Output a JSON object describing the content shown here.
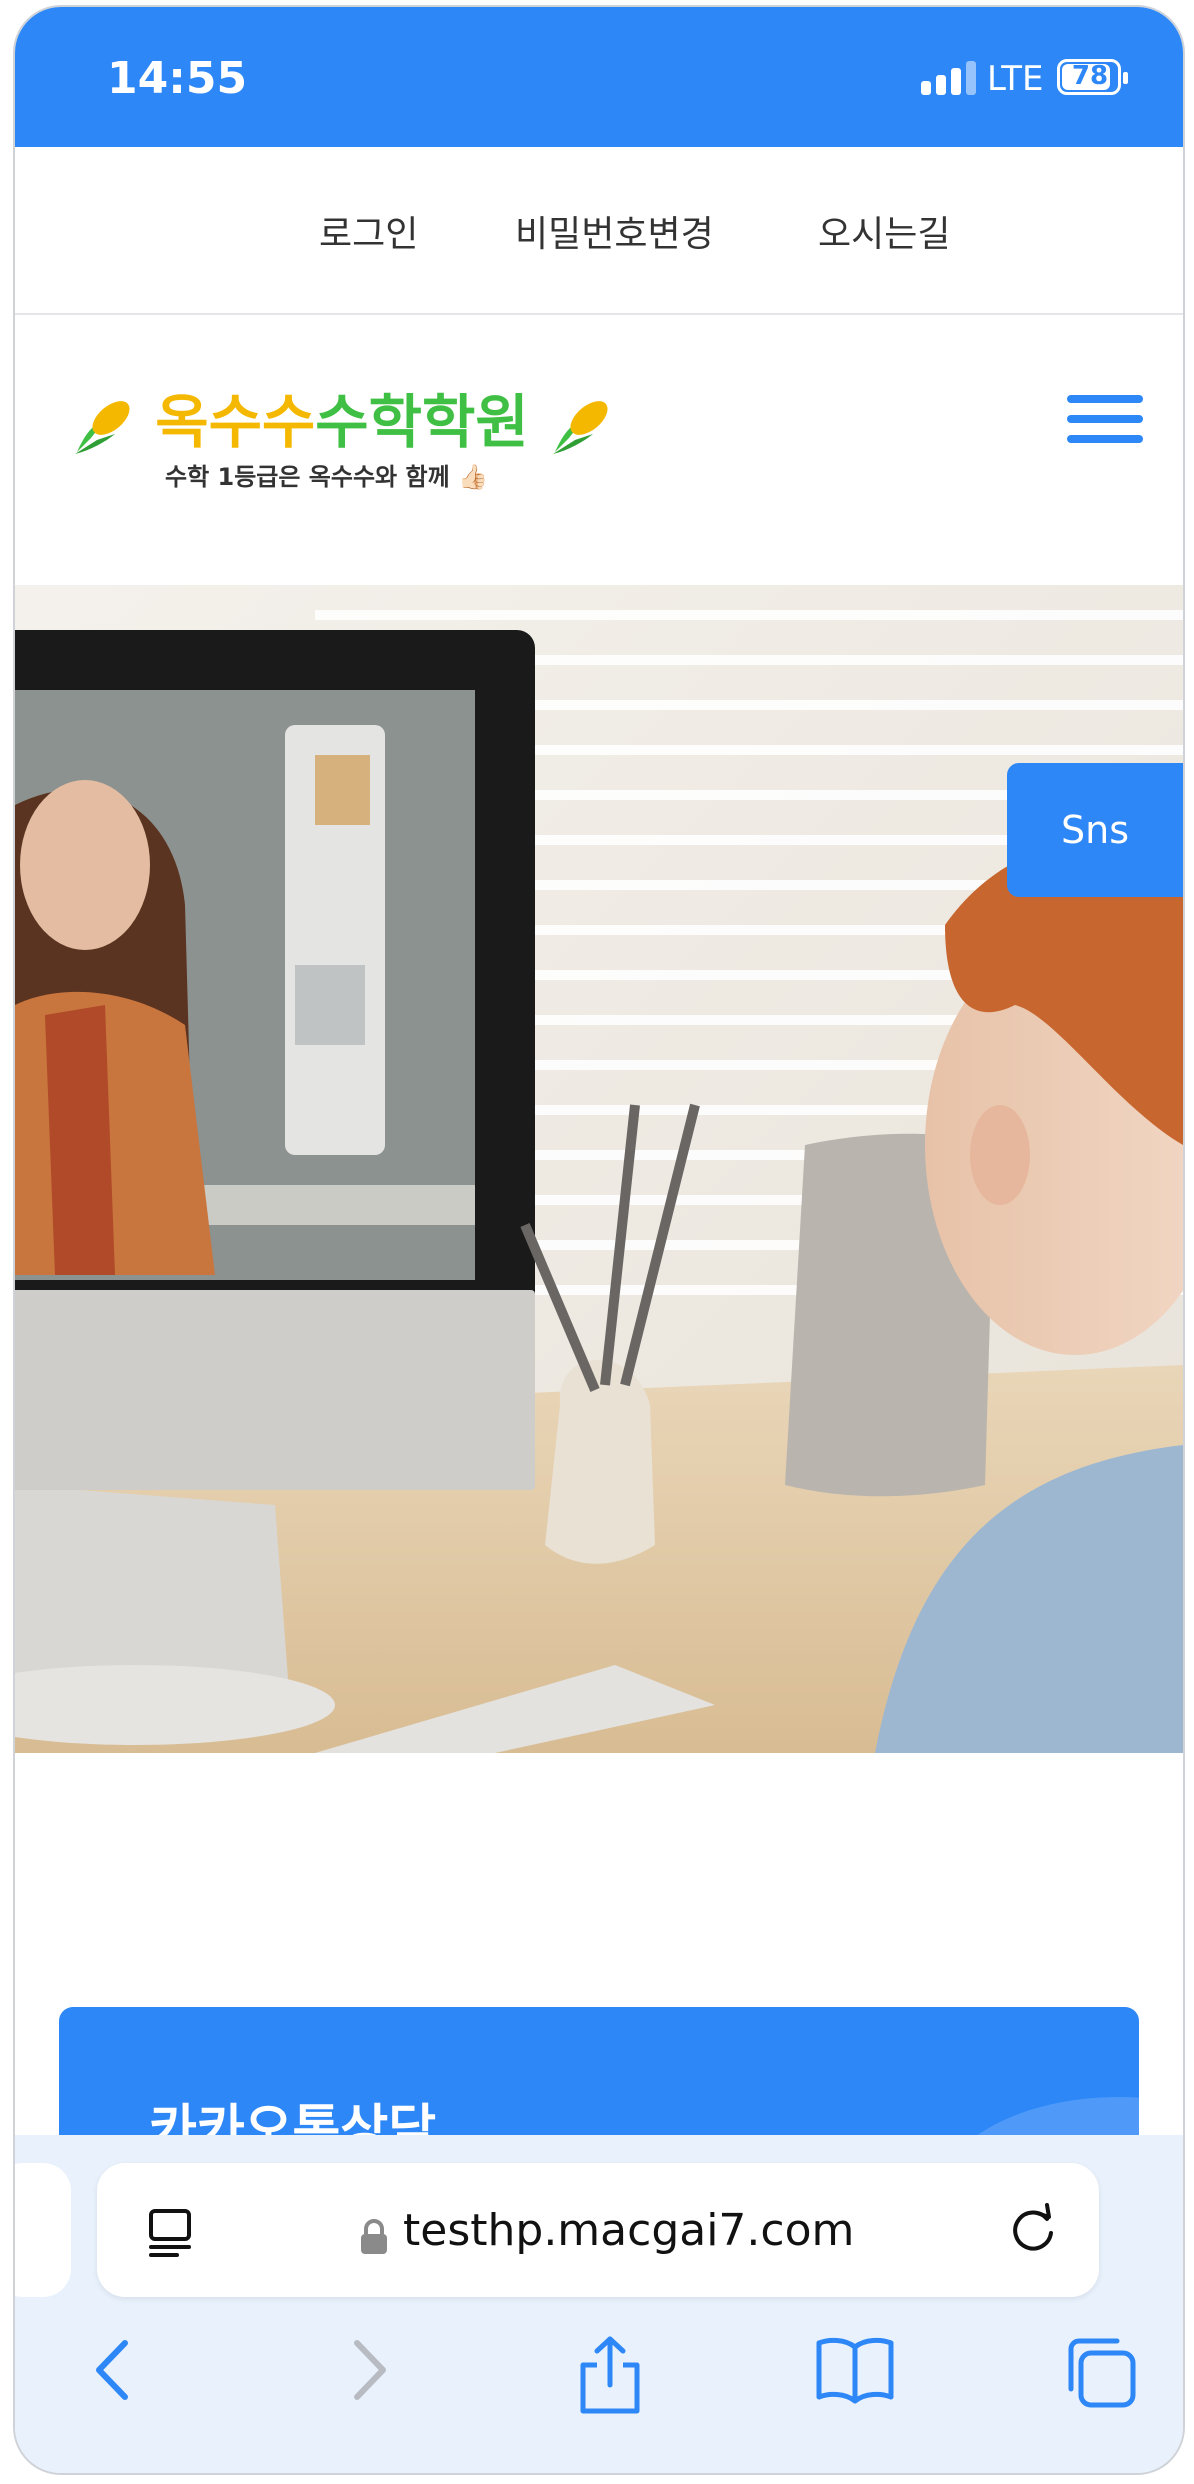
{
  "status_bar": {
    "time": "14:55",
    "network": "LTE",
    "battery": "78"
  },
  "top_nav": {
    "items": [
      "로그인",
      "비밀번호변경",
      "오시는길"
    ]
  },
  "logo": {
    "title_part1": "옥수수",
    "title_part2": "수학학원",
    "subtitle": "수학 1등급은 옥수수와 함께 👍🏻"
  },
  "sns_button": {
    "label": "Sns"
  },
  "kakao_banner": {
    "title": "카카오톡상담"
  },
  "browser": {
    "url": "testhp.macgai7.com"
  },
  "colors": {
    "accent": "#2d87f7",
    "logo_yellow": "#f5b800",
    "logo_green": "#3fbf43"
  },
  "icons": [
    "signal-icon",
    "battery-icon",
    "hamburger-menu-icon",
    "corn-icon",
    "reader-icon",
    "lock-icon",
    "reload-icon",
    "back-icon",
    "forward-icon",
    "share-icon",
    "bookmarks-icon",
    "tabs-icon"
  ]
}
